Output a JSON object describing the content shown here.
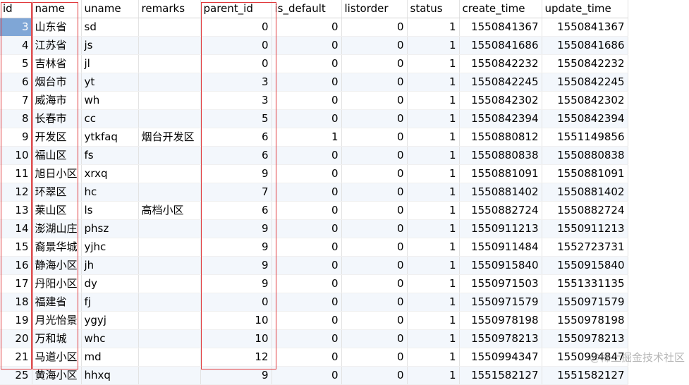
{
  "columns": [
    "id",
    "name",
    "uname",
    "remarks",
    "parent_id",
    "is_default",
    "listorder",
    "status",
    "create_time",
    "update_time"
  ],
  "rows": [
    [
      "3",
      "山东省",
      "sd",
      "",
      "0",
      "0",
      "0",
      "1",
      "1550841367",
      "1550841367"
    ],
    [
      "4",
      "江苏省",
      "js",
      "",
      "0",
      "0",
      "0",
      "1",
      "1550841686",
      "1550841686"
    ],
    [
      "5",
      "吉林省",
      "jl",
      "",
      "0",
      "0",
      "0",
      "1",
      "1550842232",
      "1550842232"
    ],
    [
      "6",
      "烟台市",
      "yt",
      "",
      "3",
      "0",
      "0",
      "1",
      "1550842245",
      "1550842245"
    ],
    [
      "7",
      "威海市",
      "wh",
      "",
      "3",
      "0",
      "0",
      "1",
      "1550842302",
      "1550842302"
    ],
    [
      "8",
      "长春市",
      "cc",
      "",
      "5",
      "0",
      "0",
      "1",
      "1550842394",
      "1550842394"
    ],
    [
      "9",
      "开发区",
      "ytkfaq",
      "烟台开发区",
      "6",
      "1",
      "0",
      "1",
      "1550880812",
      "1551149856"
    ],
    [
      "10",
      "福山区",
      "fs",
      "",
      "6",
      "0",
      "0",
      "1",
      "1550880838",
      "1550880838"
    ],
    [
      "11",
      "旭日小区",
      "xrxq",
      "",
      "9",
      "0",
      "0",
      "1",
      "1550881091",
      "1550881091"
    ],
    [
      "12",
      "环翠区",
      "hc",
      "",
      "7",
      "0",
      "0",
      "1",
      "1550881402",
      "1550881402"
    ],
    [
      "13",
      "莱山区",
      "ls",
      "高档小区",
      "6",
      "0",
      "0",
      "1",
      "1550882724",
      "1550882724"
    ],
    [
      "14",
      "澎湖山庄",
      "phsz",
      "",
      "9",
      "0",
      "0",
      "1",
      "1550911213",
      "1550911213"
    ],
    [
      "15",
      "裔景华城",
      "yjhc",
      "",
      "9",
      "0",
      "0",
      "1",
      "1550911484",
      "1552723731"
    ],
    [
      "16",
      "静海小区",
      "jh",
      "",
      "9",
      "0",
      "0",
      "1",
      "1550915840",
      "1550915840"
    ],
    [
      "17",
      "丹阳小区",
      "dy",
      "",
      "9",
      "0",
      "0",
      "1",
      "1550971503",
      "1551331135"
    ],
    [
      "18",
      "福建省",
      "fj",
      "",
      "0",
      "0",
      "0",
      "1",
      "1550971579",
      "1550971579"
    ],
    [
      "19",
      "月光怡景",
      "ygyj",
      "",
      "10",
      "0",
      "0",
      "1",
      "1550978198",
      "1550978198"
    ],
    [
      "20",
      "万和城",
      "whc",
      "",
      "10",
      "0",
      "0",
      "1",
      "1550978213",
      "1550978213"
    ],
    [
      "21",
      "马道小区",
      "md",
      "",
      "12",
      "0",
      "0",
      "1",
      "1550994347",
      "1550994847"
    ],
    [
      "25",
      "黄海小区",
      "hhxq",
      "",
      "9",
      "0",
      "0",
      "1",
      "1551582127",
      "1551582127"
    ]
  ],
  "watermark": "@稀土掘金技术社区"
}
